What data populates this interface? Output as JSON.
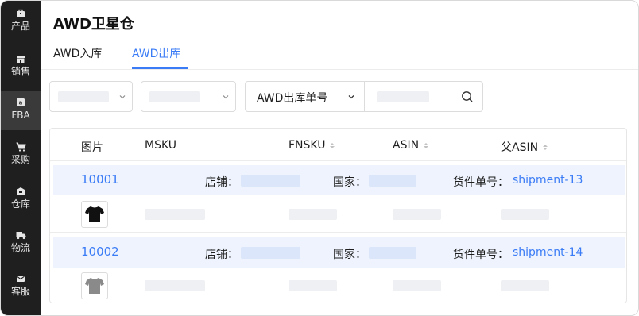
{
  "sidebar": {
    "items": [
      {
        "label": "产品",
        "icon": "product-icon",
        "active": false
      },
      {
        "label": "销售",
        "icon": "store-icon",
        "active": false
      },
      {
        "label": "FBA",
        "icon": "amazon-icon",
        "active": true
      },
      {
        "label": "采购",
        "icon": "cart-icon",
        "active": false
      },
      {
        "label": "仓库",
        "icon": "warehouse-icon",
        "active": false
      },
      {
        "label": "物流",
        "icon": "truck-icon",
        "active": false
      },
      {
        "label": "客服",
        "icon": "mail-icon",
        "active": false
      }
    ]
  },
  "header": {
    "title": "AWD卫星仓"
  },
  "tabs": [
    {
      "label": "AWD入库",
      "active": false
    },
    {
      "label": "AWD出库",
      "active": true
    }
  ],
  "filters": {
    "search_field_label": "AWD出库单号"
  },
  "table": {
    "columns": [
      "图片",
      "MSKU",
      "FNSKU",
      "ASIN",
      "父ASIN"
    ],
    "groups": [
      {
        "id": "10001",
        "shop_label": "店铺：",
        "country_label": "国家：",
        "shipment_label": "货件单号：",
        "shipment": "shipment-13",
        "thumb": "black-tshirt"
      },
      {
        "id": "10002",
        "shop_label": "店铺：",
        "country_label": "国家：",
        "shipment_label": "货件单号：",
        "shipment": "shipment-14",
        "thumb": "gray-tshirt"
      }
    ]
  },
  "colors": {
    "accent": "#3a7bf6",
    "sidebar_bg": "#1f1f1f",
    "group_bg": "#eef3fd"
  }
}
